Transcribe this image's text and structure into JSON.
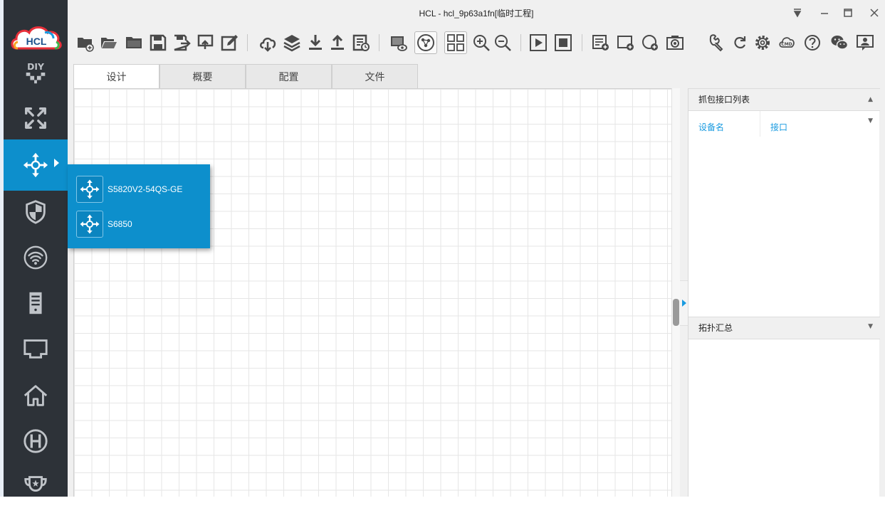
{
  "window": {
    "title": "HCL - hcl_9p63a1fn[临时工程]",
    "controls": [
      "menu",
      "minimize",
      "maximize",
      "close"
    ]
  },
  "logo": {
    "text": "HCL",
    "colors": [
      "#e8303a",
      "#f5a623",
      "#3cb54a",
      "#1a9be0"
    ]
  },
  "sidebar": {
    "items": [
      {
        "name": "diy",
        "icon": "diy-icon",
        "label": "DIY"
      },
      {
        "name": "router",
        "icon": "router-icon"
      },
      {
        "name": "switch",
        "icon": "switch-icon",
        "active": true
      },
      {
        "name": "firewall",
        "icon": "shield-icon"
      },
      {
        "name": "wireless",
        "icon": "wifi-icon"
      },
      {
        "name": "server",
        "icon": "server-icon"
      },
      {
        "name": "terminal",
        "icon": "monitor-icon"
      },
      {
        "name": "host",
        "icon": "home-icon"
      },
      {
        "name": "h3c",
        "icon": "h-logo-icon"
      },
      {
        "name": "trophy",
        "icon": "trophy-icon"
      }
    ]
  },
  "toolbar": {
    "groups": [
      [
        "new-project-icon",
        "open-project-icon",
        "open-folder-icon",
        "save-icon",
        "save-as-icon",
        "import-icon",
        "edit-icon"
      ],
      [
        "cloud-download-icon",
        "layers-icon",
        "download-icon",
        "upload-icon",
        "log-icon"
      ],
      [
        "screenshot-view-icon",
        "topology-icon",
        "grid-icon",
        "zoom-in-icon",
        "zoom-out-icon"
      ],
      [
        "start-all-icon",
        "stop-all-icon"
      ],
      [
        "add-list-icon",
        "add-frame-icon",
        "add-circle-icon",
        "camera-icon"
      ],
      [
        "tools-icon",
        "refresh-icon",
        "settings-icon",
        "cmd-icon",
        "help-icon",
        "wechat-icon",
        "user-icon"
      ]
    ]
  },
  "tabs": [
    {
      "label": "设计",
      "active": true
    },
    {
      "label": "概要"
    },
    {
      "label": "配置"
    },
    {
      "label": "文件"
    }
  ],
  "capture_panel": {
    "title": "抓包接口列表",
    "columns": [
      "设备名",
      "接口"
    ]
  },
  "topology_panel": {
    "title": "拓扑汇总"
  },
  "device_popup": {
    "items": [
      {
        "label": "S5820V2-54QS-GE",
        "icon": "switch-icon"
      },
      {
        "label": "S6850",
        "icon": "switch-icon"
      }
    ]
  }
}
